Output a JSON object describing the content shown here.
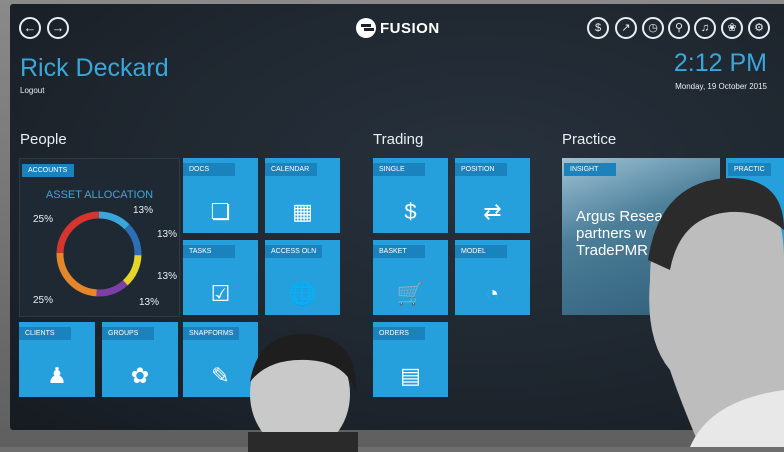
{
  "header": {
    "brand": "FUSION",
    "user_name": "Rick Deckard",
    "logout_label": "Logout",
    "time": "2:12 PM",
    "date": "Monday, 19 October 2015"
  },
  "nav_icons": [
    "back-icon",
    "forward-icon"
  ],
  "top_icons": [
    "dollar-icon",
    "chart-icon",
    "clock-icon",
    "search-icon",
    "bell-icon",
    "butterfly-icon",
    "gear-icon"
  ],
  "sections": {
    "people": "People",
    "trading": "Trading",
    "practice": "Practice"
  },
  "accounts": {
    "label": "ACCOUNTS",
    "title": "ASSET ALLOCATION",
    "chart_data": {
      "type": "pie",
      "values": [
        13,
        13,
        13,
        13,
        25,
        25
      ],
      "labels": [
        "13%",
        "13%",
        "13%",
        "13%",
        "25%",
        "25%"
      ],
      "colors": [
        "#3aa7dc",
        "#2d6fb5",
        "#e5d42a",
        "#7c3fa7",
        "#e4872b",
        "#d6342f"
      ]
    }
  },
  "tiles": {
    "docs": "DOCS",
    "calendar": "CALENDAR",
    "tasks": "TASKS",
    "access_oln": "ACCESS OLN",
    "clients": "CLIENTS",
    "groups": "GROUPS",
    "snapforms": "SNAPFORMS",
    "single": "SINGLE",
    "position": "POSITION",
    "basket": "BASKET",
    "model": "MODEL",
    "orders": "ORDERS",
    "insight": "INSIGHT",
    "insight_text_1": "Argus Resea",
    "insight_text_2": "partners w",
    "insight_text_3": "TradePMR",
    "practice_tile": "PRACTIC"
  },
  "colors": {
    "accent": "#25a0dc",
    "label_bg": "#1a83bd",
    "screen_bg": "#1c232b"
  }
}
